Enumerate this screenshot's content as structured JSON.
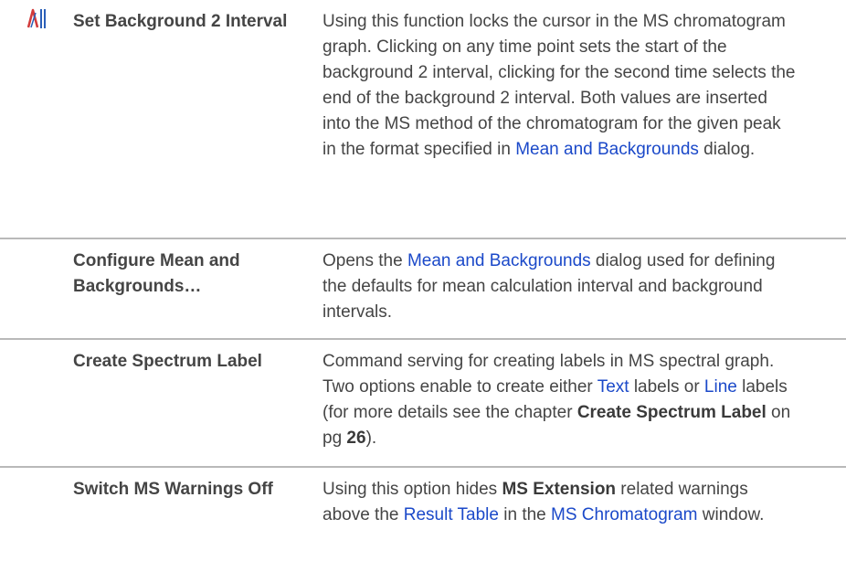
{
  "rows": [
    {
      "command": "Set Background 2 Interval",
      "desc": {
        "p1": "Using this function locks the cursor in the MS chromatogram graph. Clicking on any time point sets the start of the background 2 interval, clicking for the second time selects the end of the background 2 interval. Both values are inserted into the MS method of the chromatogram for the given peak in the format specified in ",
        "link1": "Mean and Backgrounds",
        "p2": " dialog."
      },
      "icon": "background-interval-icon"
    },
    {
      "command": "Configure Mean and Backgrounds…",
      "desc": {
        "p1": "Opens the ",
        "link1": "Mean and Backgrounds",
        "p2": " dialog used for defining the defaults for mean calculation interval and background intervals."
      }
    },
    {
      "command": "Create Spectrum Label",
      "desc": {
        "p1": "Command serving for creating labels in MS spectral graph. Two options enable to create either ",
        "link1": "Text",
        "p2": " labels or ",
        "link2": "Line",
        "p3": " labels (for more details see the chapter ",
        "bold1": "Create Spectrum Label",
        "p4": " on pg ",
        "bold2": "26",
        "p5": ")."
      }
    },
    {
      "command": "Switch MS Warnings Off",
      "desc": {
        "p1": "Using this option hides ",
        "bold1": "MS Extension",
        "p2": " related warnings above the ",
        "link1": "Result Table",
        "p3": " in the ",
        "link2": "MS Chromatogram",
        "p4": " window."
      }
    }
  ],
  "colors": {
    "link": "#1b49c9",
    "text": "#454545",
    "separator": "#b9b9b9",
    "icon_red": "#d23a3a",
    "icon_blue": "#2a5fb8"
  }
}
